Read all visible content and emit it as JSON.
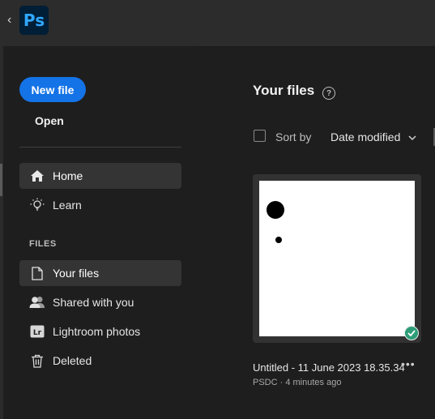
{
  "app": {
    "name": "Ps",
    "logo_icon": "photoshop-logo"
  },
  "sidebar": {
    "new_file_label": "New file",
    "open_label": "Open",
    "nav": [
      {
        "label": "Home",
        "icon": "home-icon",
        "active": true
      },
      {
        "label": "Learn",
        "icon": "lightbulb-icon",
        "active": false
      }
    ],
    "files_section_label": "FILES",
    "files_nav": [
      {
        "label": "Your files",
        "icon": "document-icon",
        "active": true
      },
      {
        "label": "Shared with you",
        "icon": "people-icon",
        "active": false
      },
      {
        "label": "Lightroom photos",
        "icon": "lightroom-icon",
        "active": false
      },
      {
        "label": "Deleted",
        "icon": "trash-icon",
        "active": false
      }
    ]
  },
  "main": {
    "title": "Your files",
    "sort_label": "Sort by",
    "sort_value": "Date modified",
    "files": [
      {
        "name": "Untitled - 11 June 2023 18.35.34",
        "meta": "PSDC · 4 minutes ago",
        "synced": true
      }
    ]
  },
  "colors": {
    "accent": "#1473e6",
    "background": "#1e1e1e",
    "sync_ok": "#2d9d78",
    "ps_logo_text": "#31a8ff",
    "ps_logo_bg": "#001e36"
  }
}
